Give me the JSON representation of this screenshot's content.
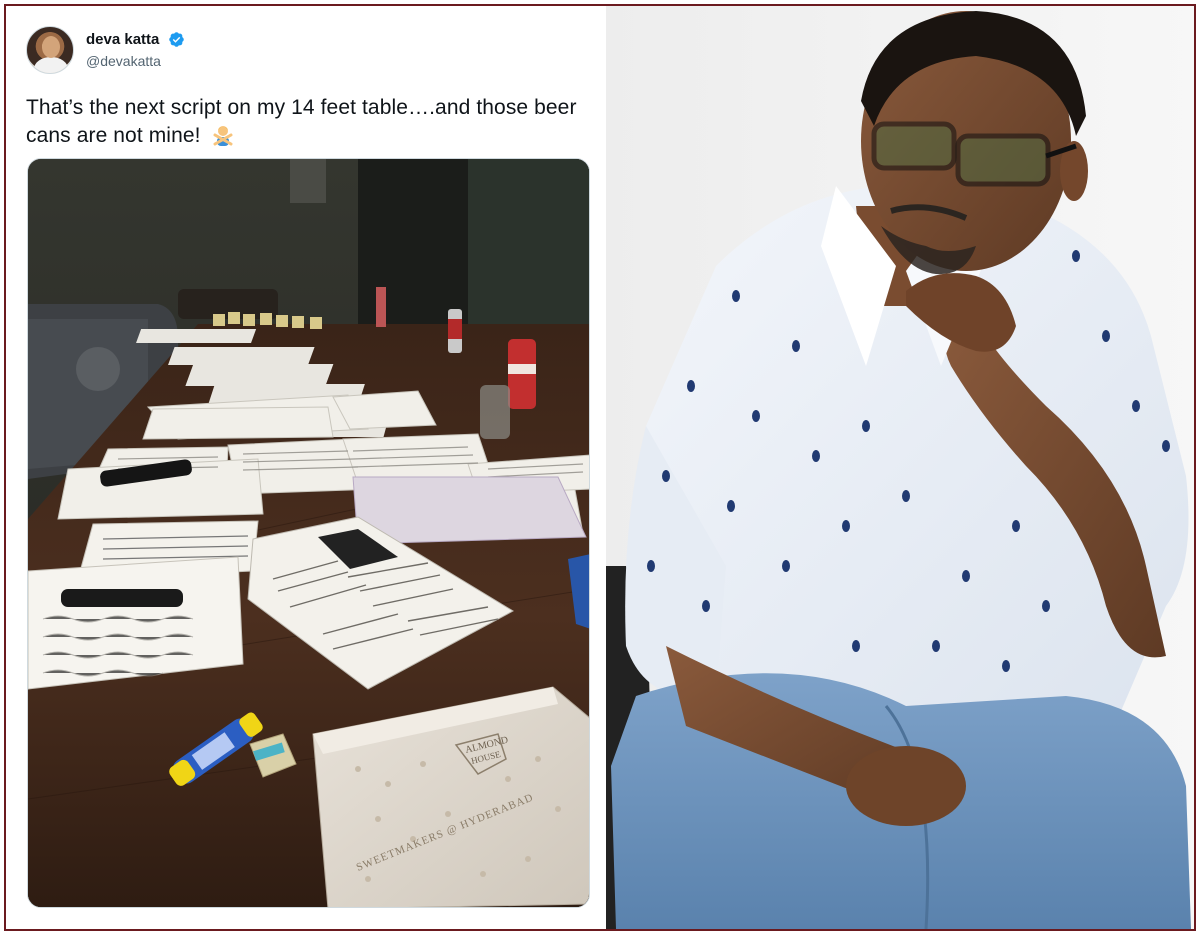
{
  "tweet": {
    "display_name": "deva katta",
    "handle": "@devakatta",
    "text": "That’s the next script on my 14 feet table….and those beer cans are not mine!",
    "emoji": "person-gesturing-no-icon",
    "verified": true
  },
  "photo": {
    "box_text_line1": "ALMOND",
    "box_text_line2": "HOUSE",
    "box_side_text": "SWEETMAKERS @ HYDERABAD"
  },
  "colors": {
    "frame": "#6b1a1f",
    "verified_blue": "#1d9bf0",
    "text_primary": "#0f1419",
    "text_secondary": "#536471"
  }
}
